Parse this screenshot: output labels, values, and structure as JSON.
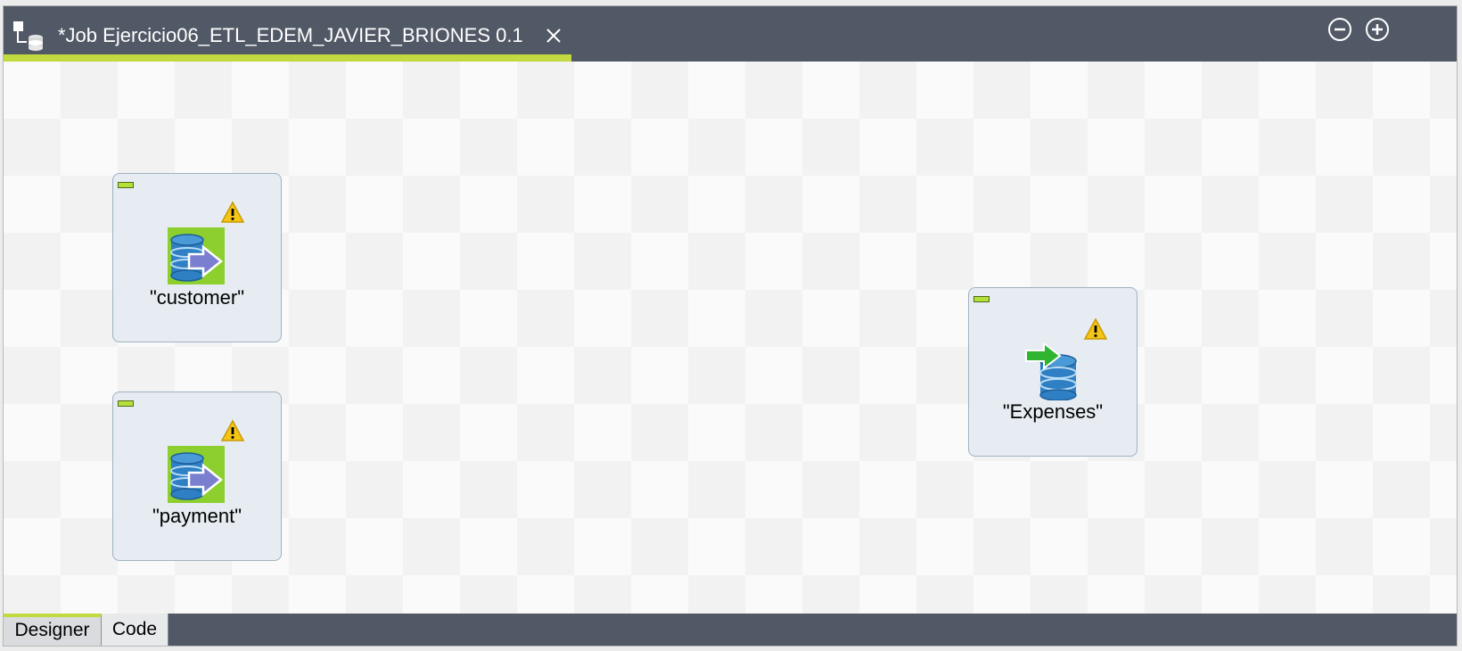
{
  "editor_tab": {
    "title": "*Job Ejercicio06_ETL_EDEM_JAVIER_BRIONES 0.1",
    "icon": "job-icon",
    "close_icon": "close-icon"
  },
  "header_controls": {
    "minimize_icon": "minus-circle-icon",
    "maximize_icon": "plus-circle-icon"
  },
  "components": [
    {
      "label": "\"customer\"",
      "type": "input",
      "icon": "db-input-icon",
      "status_icon": "warning-icon"
    },
    {
      "label": "\"payment\"",
      "type": "input",
      "icon": "db-input-icon",
      "status_icon": "warning-icon"
    },
    {
      "label": "\"Expenses\"",
      "type": "output",
      "icon": "db-output-icon",
      "status_icon": "warning-icon"
    }
  ],
  "bottom_tabs": [
    {
      "label": "Designer",
      "active": true
    },
    {
      "label": "Code",
      "active": false
    }
  ],
  "colors": {
    "header_bg": "#525966",
    "accent": "#c2d93f",
    "node_bg": "#e6ecf1",
    "node_border": "#9fb3c3",
    "input_icon_bg": "#8ccf2f",
    "output_arrow": "#2fb52f",
    "db_blue": "#2f7fc4"
  }
}
